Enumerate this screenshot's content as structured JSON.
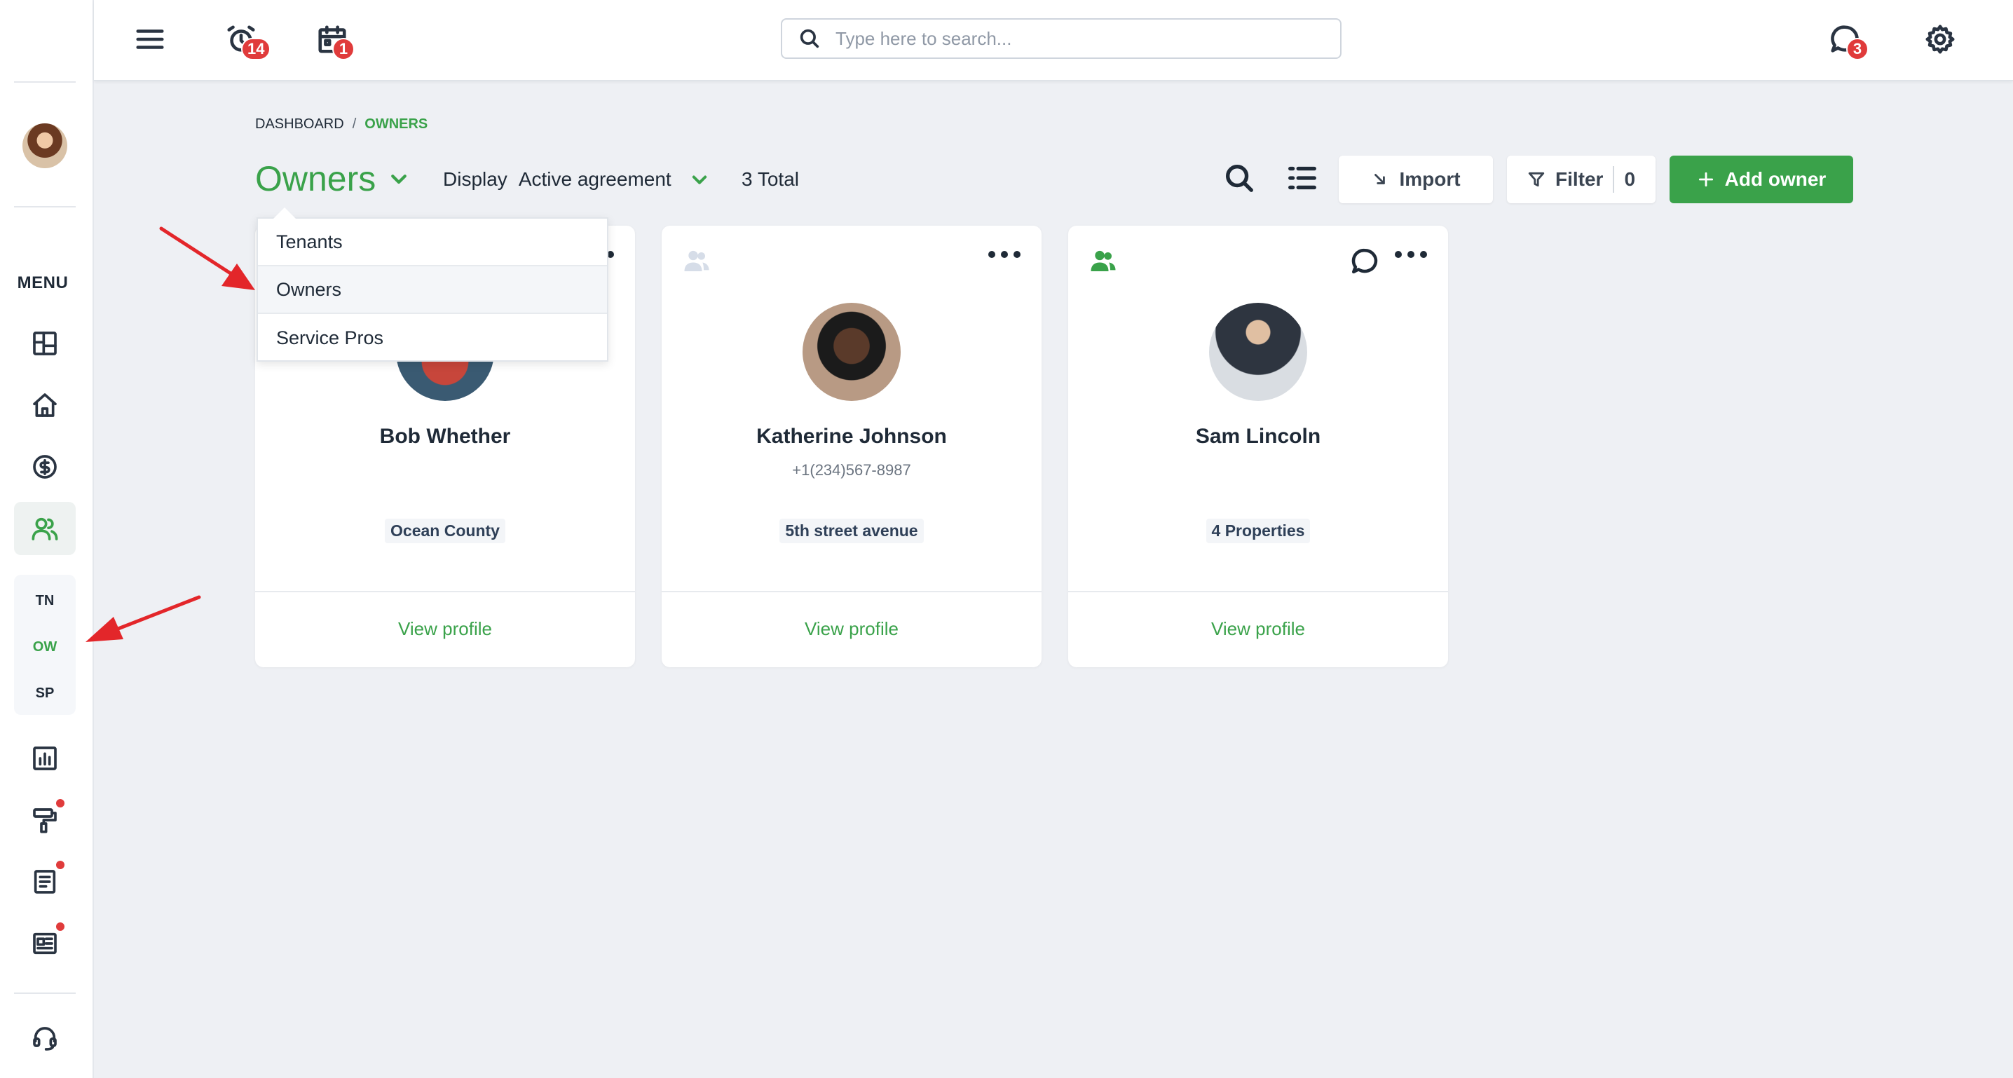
{
  "sidebar": {
    "menu_label": "MENU",
    "items": [
      {
        "name": "dashboard-icon"
      },
      {
        "name": "home-icon"
      },
      {
        "name": "dollar-icon"
      },
      {
        "name": "people-icon",
        "active": true
      },
      {
        "name": "reports-icon"
      },
      {
        "name": "paint-roller-icon",
        "dot": true
      },
      {
        "name": "document-icon",
        "dot": true
      },
      {
        "name": "news-icon",
        "dot": true
      },
      {
        "name": "support-headset-icon"
      }
    ],
    "subnav": [
      {
        "label": "TN"
      },
      {
        "label": "OW",
        "active": true
      },
      {
        "label": "SP"
      }
    ]
  },
  "header": {
    "alarm_badge": "14",
    "calendar_badge": "1",
    "messages_badge": "3",
    "search": {
      "placeholder": "Type here to search..."
    }
  },
  "breadcrumb": {
    "root": "DASHBOARD",
    "separator": "/",
    "current": "OWNERS"
  },
  "toolbar": {
    "title": "Owners",
    "display_label": "Display",
    "display_value": "Active agreement",
    "total": "3 Total",
    "import_label": "Import",
    "filter_label": "Filter",
    "filter_count": "0",
    "add_label": "Add owner"
  },
  "dropdown": {
    "items": [
      "Tenants",
      "Owners",
      "Service Pros"
    ],
    "selected": "Owners"
  },
  "cards": [
    {
      "name": "Bob Whether",
      "phone": "",
      "tag": "Ocean County",
      "action": "View profile"
    },
    {
      "name": "Katherine Johnson",
      "phone": "+1(234)567-8987",
      "tag": "5th street avenue",
      "action": "View profile"
    },
    {
      "name": "Sam Lincoln",
      "phone": "",
      "tag": "4 Properties",
      "action": "View profile"
    }
  ],
  "colors": {
    "accent": "#3aa24a",
    "badge": "#e03b3b",
    "annotation": "#e3262a"
  }
}
